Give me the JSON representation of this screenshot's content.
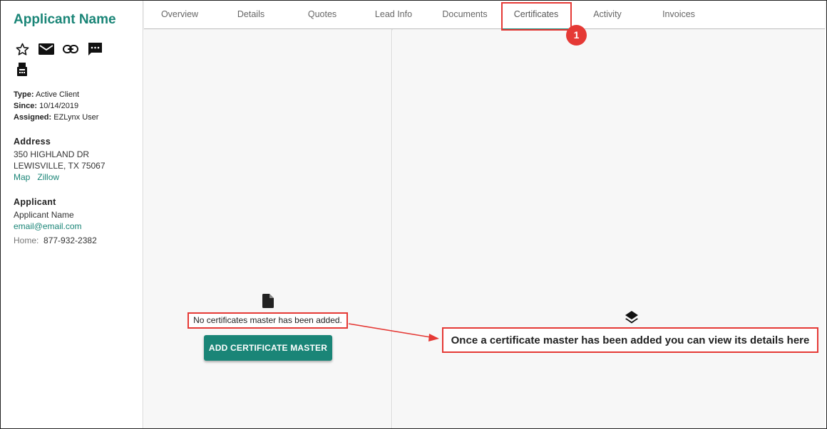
{
  "sidebar": {
    "title": "Applicant Name",
    "icons": [
      "star-outline-icon",
      "email-icon",
      "link-icon",
      "chat-icon",
      "fax-icon"
    ],
    "type_label": "Type:",
    "type_value": "Active Client",
    "since_label": "Since:",
    "since_value": "10/14/2019",
    "assigned_label": "Assigned:",
    "assigned_value": "EZLynx User",
    "address_heading": "Address",
    "address_line1": "350 HIGHLAND DR",
    "address_line2": "LEWISVILLE, TX 75067",
    "map_link": "Map",
    "zillow_link": "Zillow",
    "applicant_heading": "Applicant",
    "applicant_name": "Applicant Name",
    "applicant_email": "email@email.com",
    "home_label": "Home:",
    "home_phone": "877-932-2382"
  },
  "tabs": [
    {
      "label": "Overview"
    },
    {
      "label": "Details"
    },
    {
      "label": "Quotes"
    },
    {
      "label": "Lead Info"
    },
    {
      "label": "Documents"
    },
    {
      "label": "Certificates"
    },
    {
      "label": "Activity"
    },
    {
      "label": "Invoices"
    }
  ],
  "active_tab": "Certificates",
  "callout_number": "1",
  "left_panel": {
    "empty_message": "No certificates master has been added.",
    "add_button": "ADD CERTIFICATE MASTER"
  },
  "right_panel": {
    "info_message": "Once a certificate master has been added you can view its details here"
  },
  "colors": {
    "accent": "#1a8577",
    "annotation": "#e53935",
    "panel_bg": "#f7f7f7"
  }
}
